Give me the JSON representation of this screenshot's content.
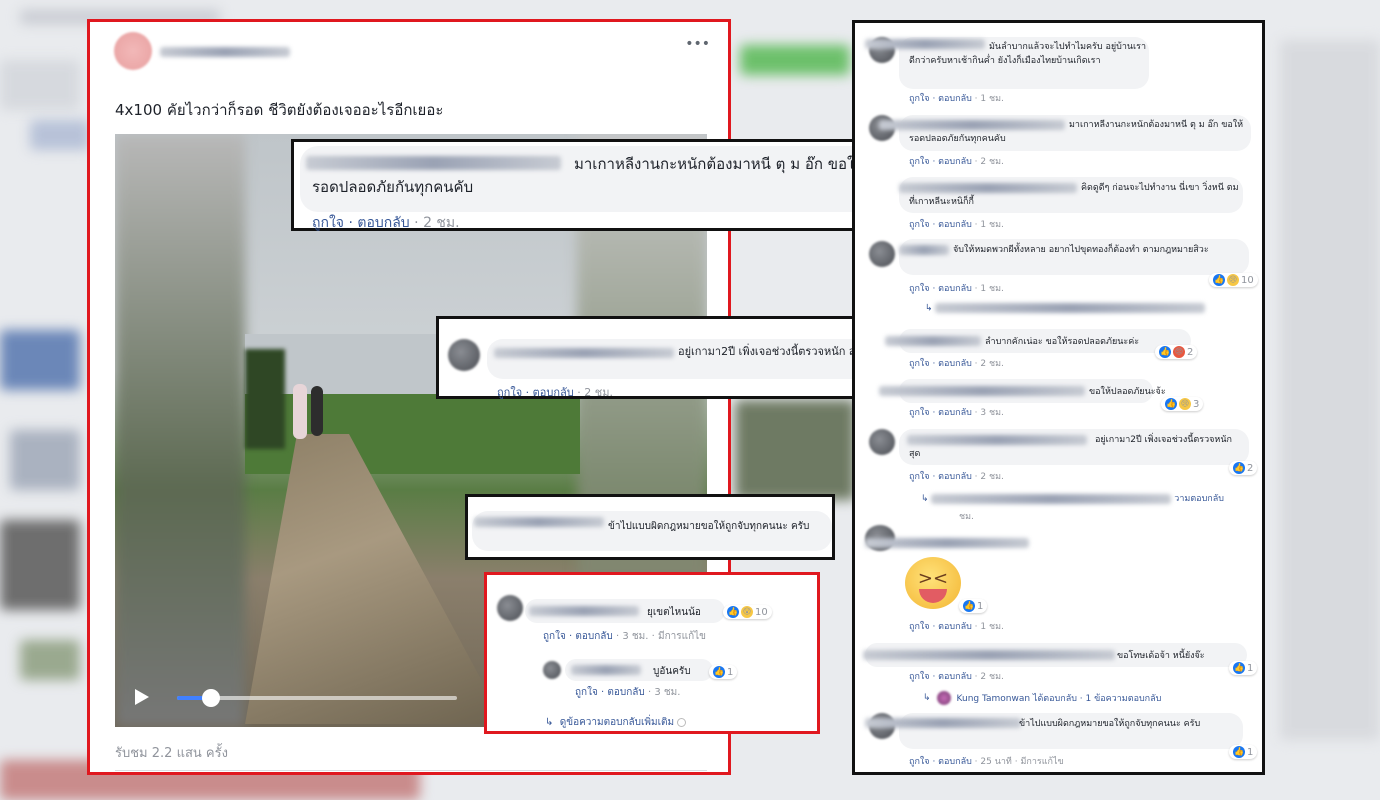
{
  "post": {
    "title": "4x100 คัยไวกว่าก็รอด ชีวิตยังต้องเจออะไรอีกเยอะ",
    "more_icon": "•••",
    "views": "รับชม 2.2 แสน ครั้ง",
    "video_progress": 0.12
  },
  "zoom_main": {
    "text": "มาเกาหลีงานกะหนักต้องมาหนี ตุ ม อ๊ก ขอให้รอดปลอดภัยกันทุกคนคับ",
    "meta_like": "ถูกใจ",
    "meta_reply": "ตอบกลับ",
    "meta_time": "2 ชม."
  },
  "zoom_2": {
    "text": "อยู่เกามา2ปี เพิ่งเจอช่วงนี้ตรวจหนัก สุด",
    "meta_like": "ถูกใจ",
    "meta_reply": "ตอบกลับ",
    "meta_time": "2 ชม."
  },
  "zoom_3": {
    "text": "ข้าไปแบบผิดกฎหมายขอให้ถูกจับทุกคนนะ ครับ"
  },
  "zoom_red": {
    "c1_text": "ยุเขตไหนน้อ",
    "c1_react": "10",
    "c1_like": "ถูกใจ",
    "c1_reply": "ตอบกลับ",
    "c1_time": "3 ชม.",
    "c1_edited": "มีการแก้ไข",
    "c2_text": "บูอันครับ",
    "c2_react": "1",
    "c2_like": "ถูกใจ",
    "c2_reply": "ตอบกลับ",
    "c2_time": "3 ชม.",
    "more_replies": "ดูข้อความตอบกลับเพิ่มเติม"
  },
  "right": {
    "comments": [
      {
        "text": "มันลำบากแล้วจะไปทำไมครับ อยู่บ้านเราดีกว่าครับหาเช้ากินค่ำ ยังไงก็เมืองไทยบ้านเกิดเรา",
        "like": "ถูกใจ",
        "reply": "ตอบกลับ",
        "time": "1 ชม."
      },
      {
        "text": "มาเกาหลีงานกะหนักต้องมาหนี ตุ ม อ๊ก ขอให้รอดปลอดภัยกันทุกคนคับ",
        "like": "ถูกใจ",
        "reply": "ตอบกลับ",
        "time": "2 ชม."
      },
      {
        "text": "คิดดูดีๆ ก่อนจะไปทำงาน นี่เขา วิ่งหนี ตม ที่เกาหลีนะหนิก็กี้",
        "like": "ถูกใจ",
        "reply": "ตอบกลับ",
        "time": "1 ชม."
      },
      {
        "text": "จับให้หมดพวกผีทั้งหลาย อยากไปขุดทองก็ต้องทำ ตามกฎหมายสิวะ",
        "like": "ถูกใจ",
        "reply": "ตอบกลับ",
        "time": "1 ชม.",
        "react": "10"
      },
      {
        "text": "ลำบากคักเน่อะ ขอให้รอดปลอดภัยนะค่ะ",
        "like": "ถูกใจ",
        "reply": "ตอบกลับ",
        "time": "2 ชม.",
        "react": "2"
      },
      {
        "text": "ขอให้ปลอดภัยนะจ้ะ",
        "like": "ถูกใจ",
        "reply": "ตอบกลับ",
        "time": "3 ชม.",
        "react": "3"
      },
      {
        "text": "อยู่เกามา2ปี เพิ่งเจอช่วงนี้ตรวจหนัก สุด",
        "like": "ถูกใจ",
        "reply": "ตอบกลับ",
        "time": "2 ชม.",
        "react": "2"
      },
      {
        "reply_tail": "วามตอบกลับ",
        "time_tail": "ชม."
      },
      {
        "sticker_react": "1",
        "like": "ถูกใจ",
        "reply": "ตอบกลับ",
        "time": "1 ชม."
      },
      {
        "text": "ขอโทษเด้อจ้า หนี้ยังจ๊ะ",
        "like": "ถูกใจ",
        "reply": "ตอบกลับ",
        "time": "2 ชม.",
        "react": "1"
      },
      {
        "reply_user": "Kung Tamonwan ได้ตอบกลับ · 1 ข้อความตอบกลับ"
      },
      {
        "text": "ข้าไปแบบผิดกฎหมายขอให้ถูกจับทุกคนนะ ครับ",
        "like": "ถูกใจ",
        "reply": "ตอบกลับ",
        "time": "25 นาที",
        "edited": "มีการแก้ไข",
        "react": "1"
      }
    ]
  }
}
